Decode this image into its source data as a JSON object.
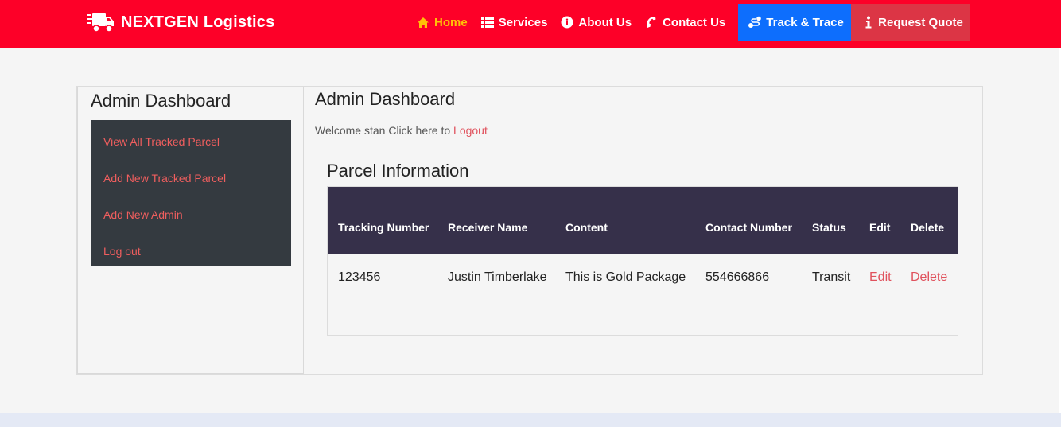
{
  "brand": {
    "name": "NEXTGEN Logistics",
    "icon": "truck-icon"
  },
  "nav": {
    "home": "Home",
    "services": "Services",
    "about": "About Us",
    "contact": "Contact Us",
    "track": "Track & Trace",
    "quote": "Request Quote"
  },
  "colors": {
    "navbar": "#fd0028",
    "active_link": "#ffc107",
    "track_button": "#0d6efd",
    "quote_button": "#dc3545",
    "sidebar_bg": "#343a40",
    "table_header": "#36304a",
    "link": "#e0525d"
  },
  "sidebar": {
    "title": "Admin Dashboard",
    "items": [
      {
        "label": "View All Tracked Parcel"
      },
      {
        "label": "Add New Tracked Parcel"
      },
      {
        "label": "Add New Admin"
      },
      {
        "label": "Log out"
      }
    ]
  },
  "main": {
    "title": "Admin Dashboard",
    "welcome_text": "Welcome stan Click here to",
    "logout_link": "Logout",
    "section_title": "Parcel Information"
  },
  "table": {
    "headers": [
      "Tracking Number",
      "Receiver Name",
      "Content",
      "Contact Number",
      "Status",
      "Edit",
      "Delete"
    ],
    "rows": [
      {
        "tracking_number": "123456",
        "receiver_name": "Justin Timberlake",
        "content": "This is Gold Package",
        "contact_number": "554666866",
        "status": "Transit",
        "edit": "Edit",
        "delete": "Delete"
      }
    ]
  }
}
